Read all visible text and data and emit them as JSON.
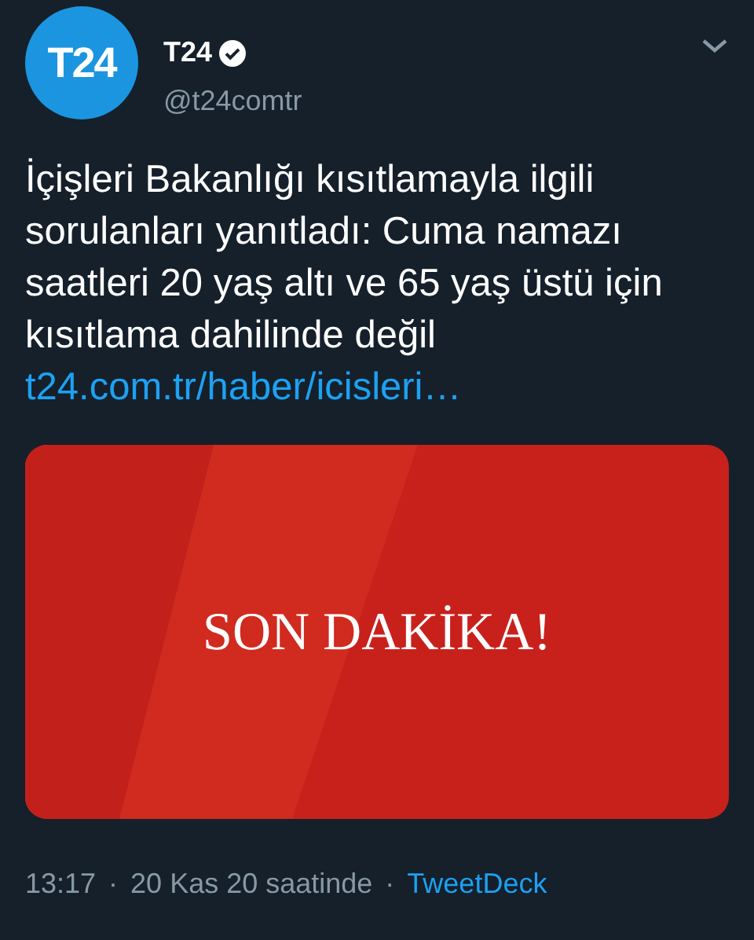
{
  "author": {
    "avatar_text": "T24",
    "name": "T24",
    "verified": true,
    "handle": "@t24comtr"
  },
  "tweet": {
    "text": "İçişleri Bakanlığı kısıtlamayla ilgili sorulanları yanıtladı: Cuma namazı saatleri 20 yaş altı ve 65 yaş üstü için kısıtlama dahilinde değil",
    "link": "t24.com.tr/haber/icisleri…"
  },
  "media": {
    "headline": "SON DAKİKA!"
  },
  "footer": [
    {
      "kind": "text",
      "text": "13:17"
    },
    {
      "kind": "text",
      "text": "·"
    },
    {
      "kind": "text",
      "text": "20 Kas 20 saatinde"
    },
    {
      "kind": "text",
      "text": "·"
    },
    {
      "kind": "link",
      "text": "TweetDeck"
    }
  ]
}
